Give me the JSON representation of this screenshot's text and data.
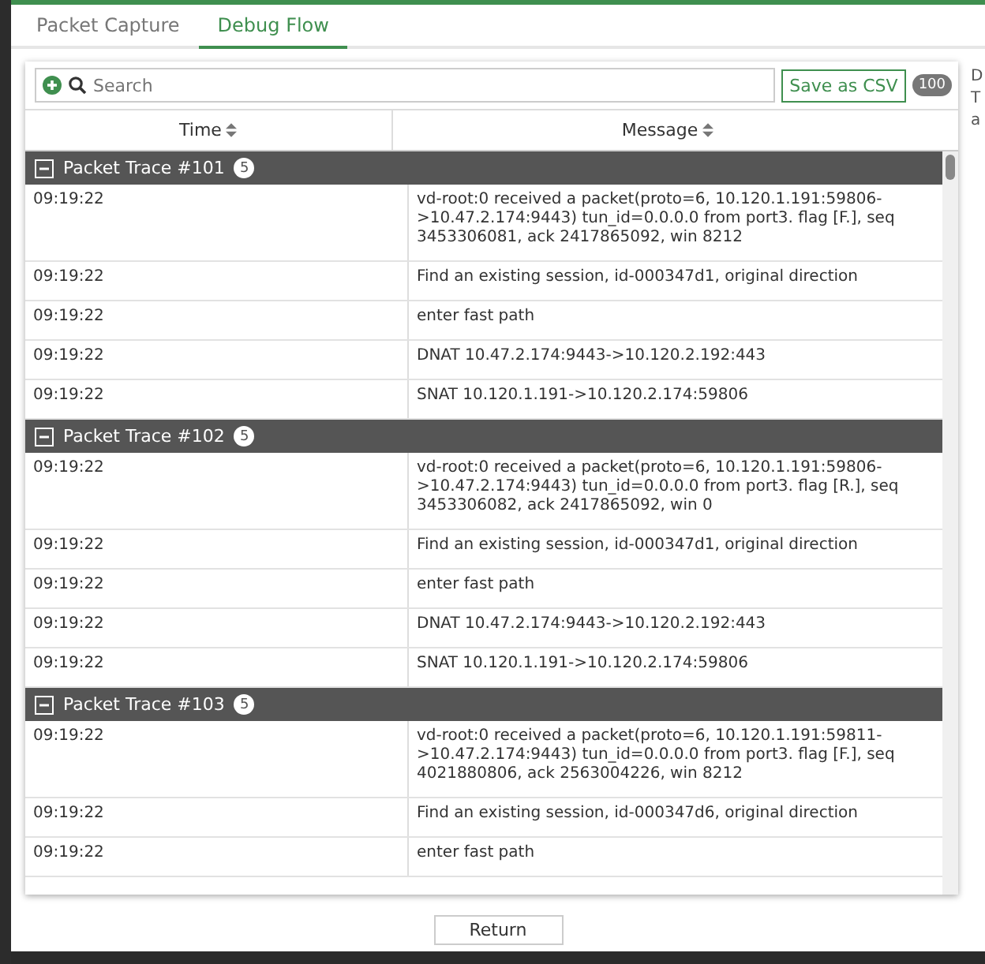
{
  "tabs": [
    {
      "label": "Packet Capture",
      "selected": false
    },
    {
      "label": "Debug Flow",
      "selected": true
    }
  ],
  "search": {
    "placeholder": "Search"
  },
  "save_button": "Save as CSV",
  "count_badge": "100",
  "table": {
    "columns": [
      "Time",
      "Message"
    ],
    "groups": [
      {
        "title": "Packet Trace #101",
        "count": "5",
        "expanded": true,
        "rows": [
          {
            "time": "09:19:22",
            "message": "vd-root:0 received a packet(proto=6, 10.120.1.191:59806->10.47.2.174:9443) tun_id=0.0.0.0 from port3. flag [F.], seq 3453306081, ack 2417865092, win 8212"
          },
          {
            "time": "09:19:22",
            "message": "Find an existing session, id-000347d1, original direction"
          },
          {
            "time": "09:19:22",
            "message": "enter fast path"
          },
          {
            "time": "09:19:22",
            "message": "DNAT 10.47.2.174:9443->10.120.2.192:443"
          },
          {
            "time": "09:19:22",
            "message": "SNAT 10.120.1.191->10.120.2.174:59806"
          }
        ]
      },
      {
        "title": "Packet Trace #102",
        "count": "5",
        "expanded": true,
        "rows": [
          {
            "time": "09:19:22",
            "message": "vd-root:0 received a packet(proto=6, 10.120.1.191:59806->10.47.2.174:9443) tun_id=0.0.0.0 from port3. flag [R.], seq 3453306082, ack 2417865092, win 0"
          },
          {
            "time": "09:19:22",
            "message": "Find an existing session, id-000347d1, original direction"
          },
          {
            "time": "09:19:22",
            "message": "enter fast path"
          },
          {
            "time": "09:19:22",
            "message": "DNAT 10.47.2.174:9443->10.120.2.192:443"
          },
          {
            "time": "09:19:22",
            "message": "SNAT 10.120.1.191->10.120.2.174:59806"
          }
        ]
      },
      {
        "title": "Packet Trace #103",
        "count": "5",
        "expanded": true,
        "rows": [
          {
            "time": "09:19:22",
            "message": "vd-root:0 received a packet(proto=6, 10.120.1.191:59811->10.47.2.174:9443) tun_id=0.0.0.0 from port3. flag [F.], seq 4021880806, ack 2563004226, win 8212"
          },
          {
            "time": "09:19:22",
            "message": "Find an existing session, id-000347d6, original direction"
          },
          {
            "time": "09:19:22",
            "message": "enter fast path"
          }
        ]
      }
    ]
  },
  "return_button": "Return",
  "side_panel": [
    "D",
    "T",
    "a"
  ]
}
